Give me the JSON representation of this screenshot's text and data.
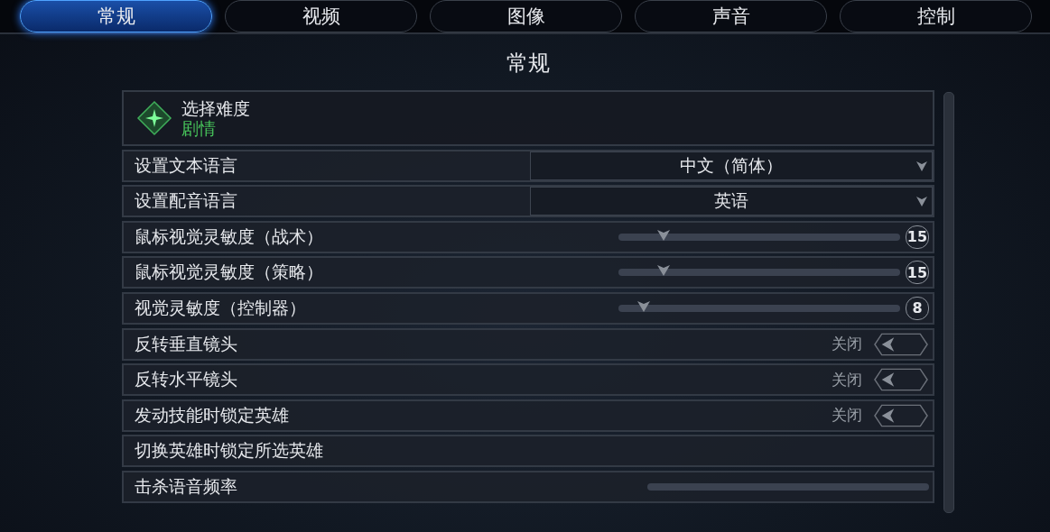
{
  "tabs": [
    {
      "label": "常规",
      "selected": true
    },
    {
      "label": "视频",
      "selected": false
    },
    {
      "label": "图像",
      "selected": false
    },
    {
      "label": "声音",
      "selected": false
    },
    {
      "label": "控制",
      "selected": false
    }
  ],
  "section_title": "常规",
  "difficulty": {
    "label": "选择难度",
    "value": "剧情"
  },
  "settings": [
    {
      "kind": "dropdown",
      "label": "设置文本语言",
      "value": "中文（简体）"
    },
    {
      "kind": "dropdown",
      "label": "设置配音语言",
      "value": "英语"
    },
    {
      "kind": "slider",
      "label": "鼠标视觉灵敏度（战术）",
      "level": 0.16,
      "value": "15"
    },
    {
      "kind": "slider",
      "label": "鼠标视觉灵敏度（策略）",
      "level": 0.16,
      "value": "15"
    },
    {
      "kind": "slider",
      "label": "视觉灵敏度（控制器）",
      "level": 0.09,
      "value": "8"
    },
    {
      "kind": "toggle",
      "label": "反转垂直镜头",
      "on": false,
      "value": "关闭"
    },
    {
      "kind": "toggle",
      "label": "反转水平镜头",
      "on": false,
      "value": "关闭"
    },
    {
      "kind": "toggle",
      "label": "发动技能时锁定英雄",
      "on": false,
      "value": "关闭"
    },
    {
      "kind": "label",
      "label": "切换英雄时锁定所选英雄"
    },
    {
      "kind": "slider",
      "label": "击杀语音频率"
    }
  ]
}
